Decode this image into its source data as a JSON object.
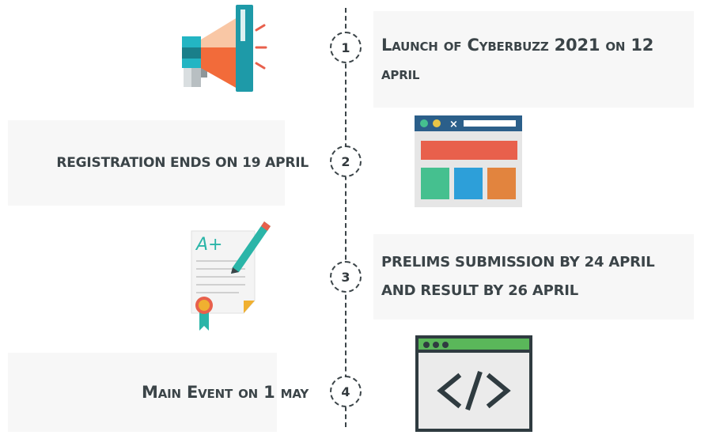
{
  "timeline": {
    "steps": [
      {
        "number": "1",
        "text": "Launch of Cyberbuzz 2021 on 12 april",
        "icon": "megaphone-icon"
      },
      {
        "number": "2",
        "text": "registration ends on 19 april",
        "icon": "browser-window-icon"
      },
      {
        "number": "3",
        "text": "prelims submission by 24 april and result by 26 april",
        "icon": "graded-certificate-icon"
      },
      {
        "number": "4",
        "text": "Main Event on 1 may",
        "icon": "code-window-icon"
      }
    ]
  },
  "colors": {
    "line": "#3b4448",
    "text": "#3b4448",
    "box": "#f7f7f7",
    "orange": "#f26b3a",
    "teal": "#1e9aa8",
    "red": "#e8604c",
    "green": "#45c08f",
    "blue": "#2d9fd9",
    "amber": "#e2843e",
    "code_green": "#5ab75a"
  }
}
